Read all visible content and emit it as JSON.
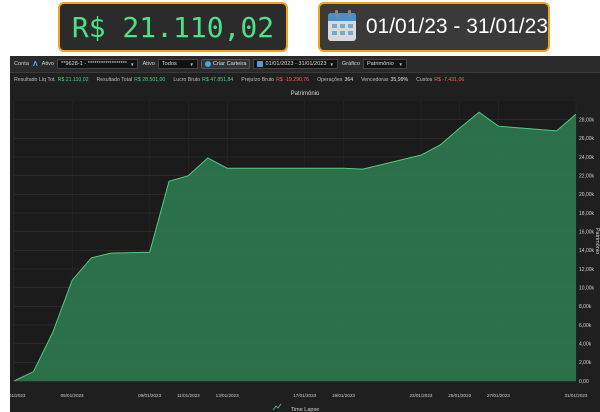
{
  "overlay": {
    "result_value": "R$ 21.110,02",
    "date_range": "01/01/23 - 31/01/23"
  },
  "toolbar": {
    "conta_label": "Conta",
    "ativo_label": "Ativo",
    "account_value": "**9628-1 - ******************",
    "ativo_filter_label": "Ativo",
    "ativo_filter_value": "Todos",
    "criar_carteira_label": "Criar Carteira",
    "date_range": "01/01/2023 - 31/01/2023",
    "grafico_label": "Gráfico",
    "grafico_value": "Patrimônio"
  },
  "stats": [
    {
      "label": "Resultado Líq Tot.",
      "value": "R$ 21.110,02",
      "tone": "pos"
    },
    {
      "label": "Resultado Total",
      "value": "R$ 28.501,00",
      "tone": "pos"
    },
    {
      "label": "Lucro Bruto",
      "value": "R$ 47.851,84",
      "tone": "pos"
    },
    {
      "label": "Prejuízo Bruto",
      "value": "R$ -19.290,76",
      "tone": "neg"
    },
    {
      "label": "Operações",
      "value": "364",
      "tone": "neu"
    },
    {
      "label": "Vencedoras",
      "value": "35,99%",
      "tone": "neu"
    },
    {
      "label": "Custos",
      "value": "R$ -7.431,06",
      "tone": "neg"
    }
  ],
  "colors": {
    "area_fill": "#2f7a4f",
    "area_line": "#46d17f",
    "accent": "#f2a51c",
    "value_green": "#4fe08c"
  },
  "chart_data": {
    "type": "area",
    "title": "Patrimônio",
    "xlabel": "Time Lapse",
    "ylabel": "Patrimônio",
    "x_ticks": [
      "02/01/2023",
      "05/01/2023",
      "09/01/2023",
      "11/01/2023",
      "13/01/2023",
      "17/01/2023",
      "19/01/2023",
      "23/01/2023",
      "25/01/2023",
      "27/01/2023",
      "31/01/2023"
    ],
    "x_days": [
      2,
      3,
      4,
      5,
      6,
      7,
      9,
      10,
      11,
      12,
      13,
      16,
      17,
      18,
      19,
      20,
      23,
      24,
      25,
      26,
      27,
      30,
      31
    ],
    "values": [
      0,
      1000,
      5200,
      10800,
      13200,
      13700,
      13800,
      21400,
      22000,
      23900,
      22800,
      22800,
      22800,
      22800,
      22800,
      22700,
      24200,
      25300,
      27100,
      28800,
      27300,
      26800,
      28600
    ],
    "yticks": [
      "0,00",
      "2,00k",
      "4,00k",
      "6,00k",
      "8,00k",
      "10,00k",
      "12,00k",
      "14,00k",
      "16,00k",
      "18,00k",
      "20,00k",
      "22,00k",
      "24,00k",
      "26,00k",
      "28,00k"
    ],
    "ylim": [
      0,
      30000
    ],
    "grid": true
  }
}
